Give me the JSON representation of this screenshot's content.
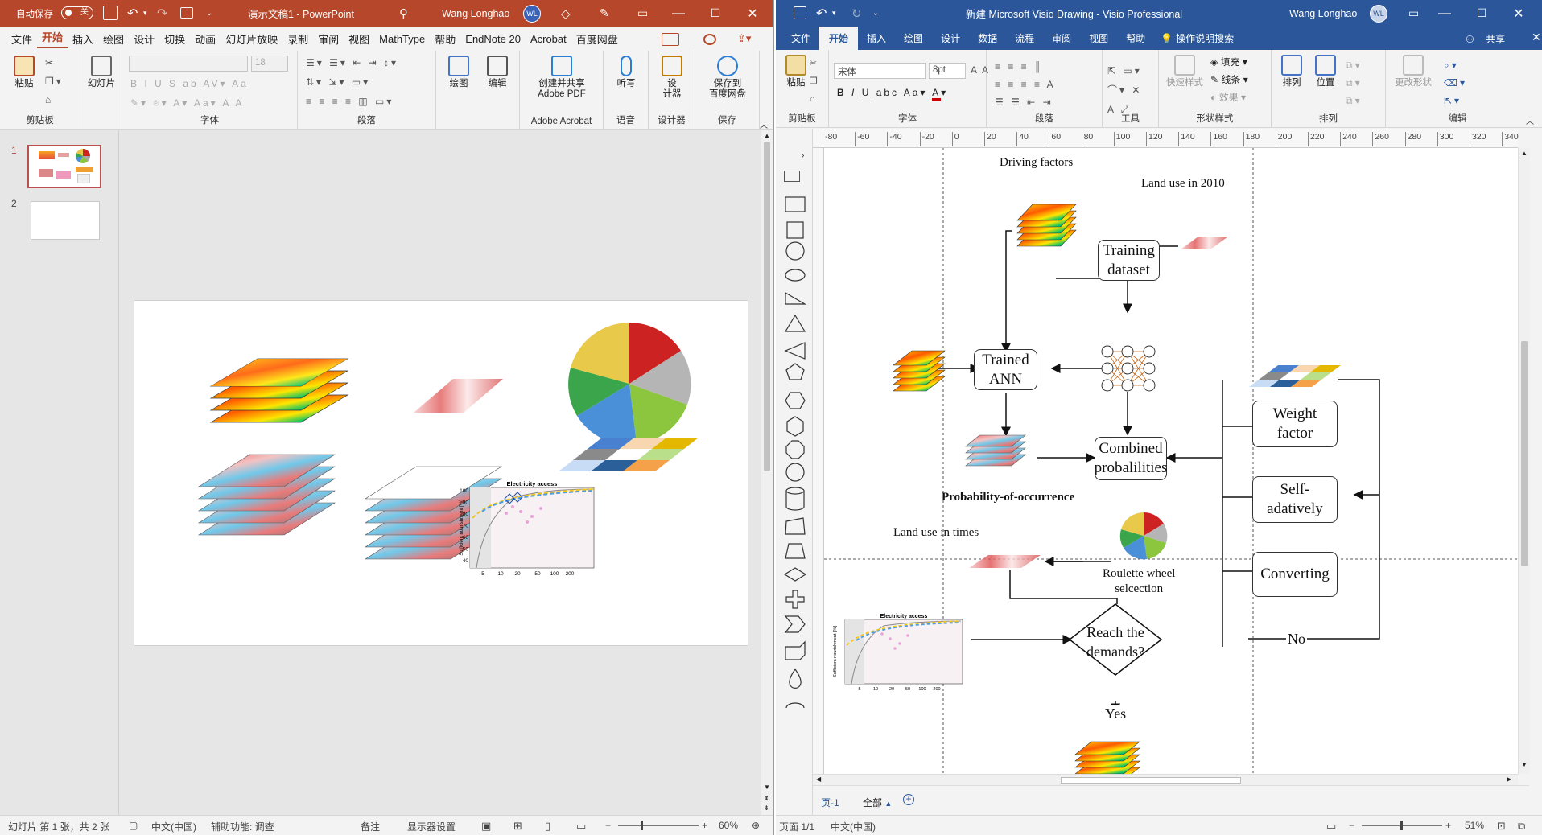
{
  "ppt": {
    "autosave": "自动保存",
    "autosave_toggle": "关",
    "title": "演示文稿1 - PowerPoint",
    "user": "Wang Longhao",
    "initials": "WL",
    "tabs": [
      "文件",
      "开始",
      "插入",
      "绘图",
      "设计",
      "切换",
      "动画",
      "幻灯片放映",
      "录制",
      "审阅",
      "视图",
      "MathType",
      "帮助",
      "EndNote 20",
      "Acrobat",
      "百度网盘"
    ],
    "ribbon": {
      "paste": "粘贴",
      "clipboard": "剪贴板",
      "slides": "幻灯片",
      "font_group": "字体",
      "font_size": "18",
      "paragraph": "段落",
      "drawing": "绘图",
      "editing": "编辑",
      "acrobat_btn": "创建并共享\nAdobe PDF",
      "acrobat_group": "Adobe Acrobat",
      "dictate": "听写",
      "voice": "语音",
      "designer": "设\n计器",
      "designer_group": "设计器",
      "save_baidu": "保存到\n百度网盘",
      "save_group": "保存"
    },
    "slides": [
      "1",
      "2"
    ],
    "chart": {
      "title": "Electricity access",
      "ylabel": "Sufficient nourishment [%]",
      "yticks": [
        "100",
        "90",
        "80",
        "70",
        "60",
        "50",
        "40"
      ],
      "xticks": [
        "5",
        "10",
        "20",
        "50",
        "100",
        "200"
      ]
    },
    "status": {
      "slide": "幻灯片 第 1 张，共 2 张",
      "lang": "中文(中国)",
      "access": "辅助功能: 调查",
      "notes": "备注",
      "display": "显示器设置",
      "zoom": "60%"
    }
  },
  "visio": {
    "title": "新建 Microsoft Visio Drawing  -  Visio Professional",
    "user": "Wang Longhao",
    "initials": "WL",
    "tabs": [
      "文件",
      "开始",
      "插入",
      "绘图",
      "设计",
      "数据",
      "流程",
      "审阅",
      "视图",
      "帮助"
    ],
    "search": "操作说明搜索",
    "share": "共享",
    "ribbon": {
      "paste": "粘贴",
      "clipboard": "剪贴板",
      "font": "宋体",
      "size": "8pt",
      "font_group": "字体",
      "paragraph": "段落",
      "tools": "工具",
      "quick_styles": "快速样式",
      "fill": "填充",
      "line": "线条",
      "effect": "效果",
      "shape_styles": "形状样式",
      "arrange_btn": "排列",
      "position": "位置",
      "arrange": "排列",
      "change_shape": "更改形状",
      "editing": "编辑"
    },
    "ruler": [
      "-80",
      "-60",
      "-40",
      "-20",
      "0",
      "20",
      "40",
      "60",
      "80",
      "100",
      "120",
      "140",
      "160",
      "180",
      "200",
      "220",
      "240",
      "260",
      "280",
      "300",
      "320",
      "340"
    ],
    "diagram": {
      "driving_factors": "Driving factors",
      "land_use_2010": "Land use in 2010",
      "training_dataset": "Training\ndataset",
      "trained_ann": "Trained\nANN",
      "weight_factor": "Weight\nfactor",
      "combined": "Combined\nprobalilities",
      "probability": "Probability-of-occurrence",
      "self_adaptively": "Self-\nadatively",
      "land_use_times": "Land use in times",
      "roulette": "Roulette wheel\nselcection",
      "converting": "Converting",
      "reach": "Reach the\ndemands?",
      "no": "No",
      "yes": "Yes"
    },
    "page_tab": "页-1",
    "all_tab": "全部",
    "status": {
      "page": "页面 1/1",
      "lang": "中文(中国)",
      "zoom": "51%"
    }
  }
}
